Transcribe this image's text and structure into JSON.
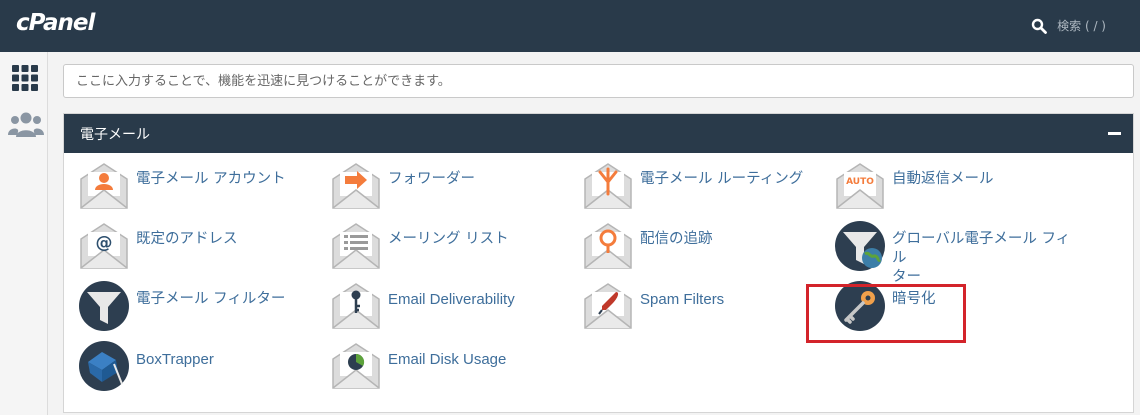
{
  "app": {
    "logo": "cPanel"
  },
  "header": {
    "search_label": "検索 ( / )"
  },
  "search": {
    "placeholder": "ここに入力することで、機能を迅速に見つけることができます。"
  },
  "section": {
    "title": "電子メール",
    "items": [
      {
        "label": "電子メール アカウント",
        "icon": "email-account-icon"
      },
      {
        "label": "フォワーダー",
        "icon": "forwarder-icon"
      },
      {
        "label": "電子メール ルーティング",
        "icon": "email-routing-icon"
      },
      {
        "label": "自動返信メール",
        "icon": "autoresponder-icon"
      },
      {
        "label": "既定のアドレス",
        "icon": "default-address-icon"
      },
      {
        "label": "メーリング リスト",
        "icon": "mailing-list-icon"
      },
      {
        "label": "配信の追跡",
        "icon": "track-delivery-icon"
      },
      {
        "label": "グローバル電子メール フィル\nター",
        "icon": "global-email-filter-icon"
      },
      {
        "label": "電子メール フィルター",
        "icon": "email-filter-icon"
      },
      {
        "label": "Email Deliverability",
        "icon": "email-deliverability-icon"
      },
      {
        "label": "Spam Filters",
        "icon": "spam-filters-icon"
      },
      {
        "label": "暗号化",
        "icon": "encryption-icon"
      },
      {
        "label": "BoxTrapper",
        "icon": "boxtrapper-icon"
      },
      {
        "label": "Email Disk Usage",
        "icon": "email-disk-usage-icon"
      }
    ]
  },
  "colors": {
    "header_bg": "#293a4a",
    "link": "#3e6e9b",
    "accent": "#f47c3c",
    "highlight": "#d3232a"
  }
}
